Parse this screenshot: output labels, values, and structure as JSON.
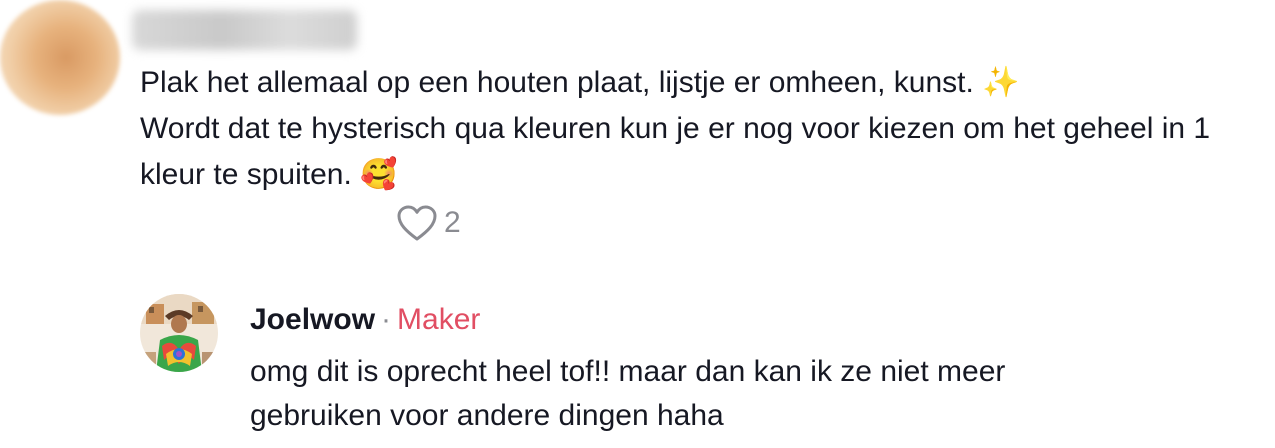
{
  "comment": {
    "username": "",
    "text": "Plak het allemaal op een houten plaat, lijstje er omheen, kunst. ✨\nWordt dat te hysterisch qua kleuren kun je er nog voor kiezen om het geheel in 1 kleur te spuiten. 🥰",
    "likes": "2",
    "heart_icon": "heart-outline-icon"
  },
  "reply": {
    "username": "Joelwow",
    "separator": "·",
    "badge": "Maker",
    "badge_color": "#e14e63",
    "text": "omg dit is oprecht heel tof!! maar dan kan ik ze niet meer\ngebruiken voor andere dingen haha"
  }
}
